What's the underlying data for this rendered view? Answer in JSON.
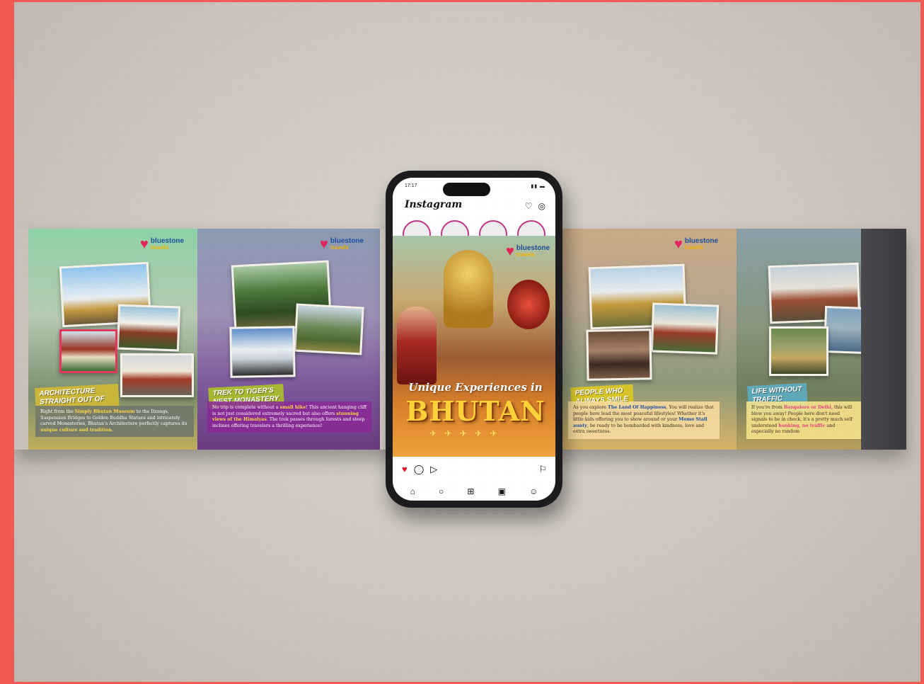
{
  "brand": {
    "name": "bluestone",
    "sub": "travels"
  },
  "panels": [
    {
      "tag": "Architecture straight out of anime",
      "text_parts": [
        "Right from the ",
        "Simply Bhutan Museum",
        " to the Dzongs, Suspension Bridges to Golden Buddha Statues and intricately carved Monasteries, Bhutan's Architecture perfectly captures its ",
        "unique culture and tradition",
        "."
      ]
    },
    {
      "tag": "Trek to Tiger's nest monastery",
      "text_parts": [
        "No trip is complete without a ",
        "small hike",
        "! This ancient hanging cliff is not just considered extremely sacred but also offers ",
        "stunning views of the Himalyas",
        ". The trek passes through forests and steep inclines offering travelers a thrilling experience!"
      ]
    },
    {
      "tag": "People who always smile",
      "text_parts": [
        "As you explore ",
        "The Land Of Happiness",
        ", You will realize that people here lead the most peaceful lifestyles! Whether it's little kids offering you to show around or your ",
        "Momo Stall aunty",
        ", be ready to be bombarded with kindness, love and extra sweetness."
      ]
    },
    {
      "tag": "Life without traffic lights",
      "text_parts": [
        "If you're from ",
        "Bangalore or Delhi",
        ", this will blow you away! People here don't need signals to be in check, it's a pretty much self understood ",
        "honking, no traffic",
        " and especially no random"
      ]
    }
  ],
  "phone": {
    "time": "17:17",
    "app_title": "Instagram",
    "post": {
      "subtitle": "Unique Experiences in",
      "title": "BHUTAN"
    }
  }
}
